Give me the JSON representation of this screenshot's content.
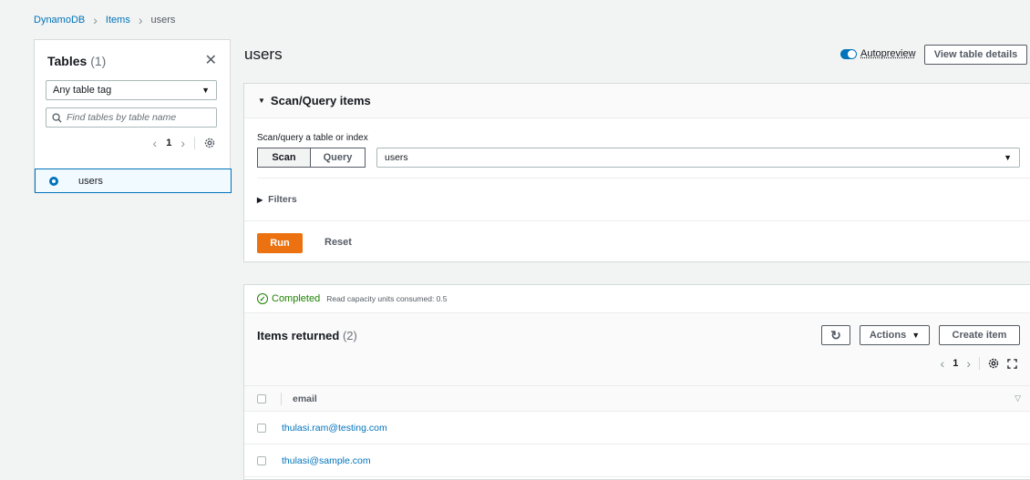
{
  "breadcrumb": {
    "root": "DynamoDB",
    "items": "Items",
    "current": "users"
  },
  "tables_panel": {
    "title": "Tables",
    "count": "(1)",
    "tag_select": "Any table tag",
    "search_placeholder": "Find tables by table name",
    "page": "1",
    "selected_table": "users"
  },
  "page_title": "users",
  "header": {
    "autopreview": "Autopreview",
    "view_details": "View table details"
  },
  "scan": {
    "title": "Scan/Query items",
    "label": "Scan/query a table or index",
    "scan_btn": "Scan",
    "query_btn": "Query",
    "table_value": "users",
    "filters": "Filters",
    "run": "Run",
    "reset": "Reset"
  },
  "results": {
    "status": "Completed",
    "rcu": "Read capacity units consumed: 0.5",
    "title": "Items returned",
    "count": "(2)",
    "actions": "Actions",
    "create": "Create item",
    "page": "1",
    "column": "email",
    "rows": [
      "thulasi.ram@testing.com",
      "thulasi@sample.com"
    ]
  },
  "colors": {
    "accent": "#0073bb",
    "primary": "#ec7211",
    "success": "#1d8102"
  }
}
